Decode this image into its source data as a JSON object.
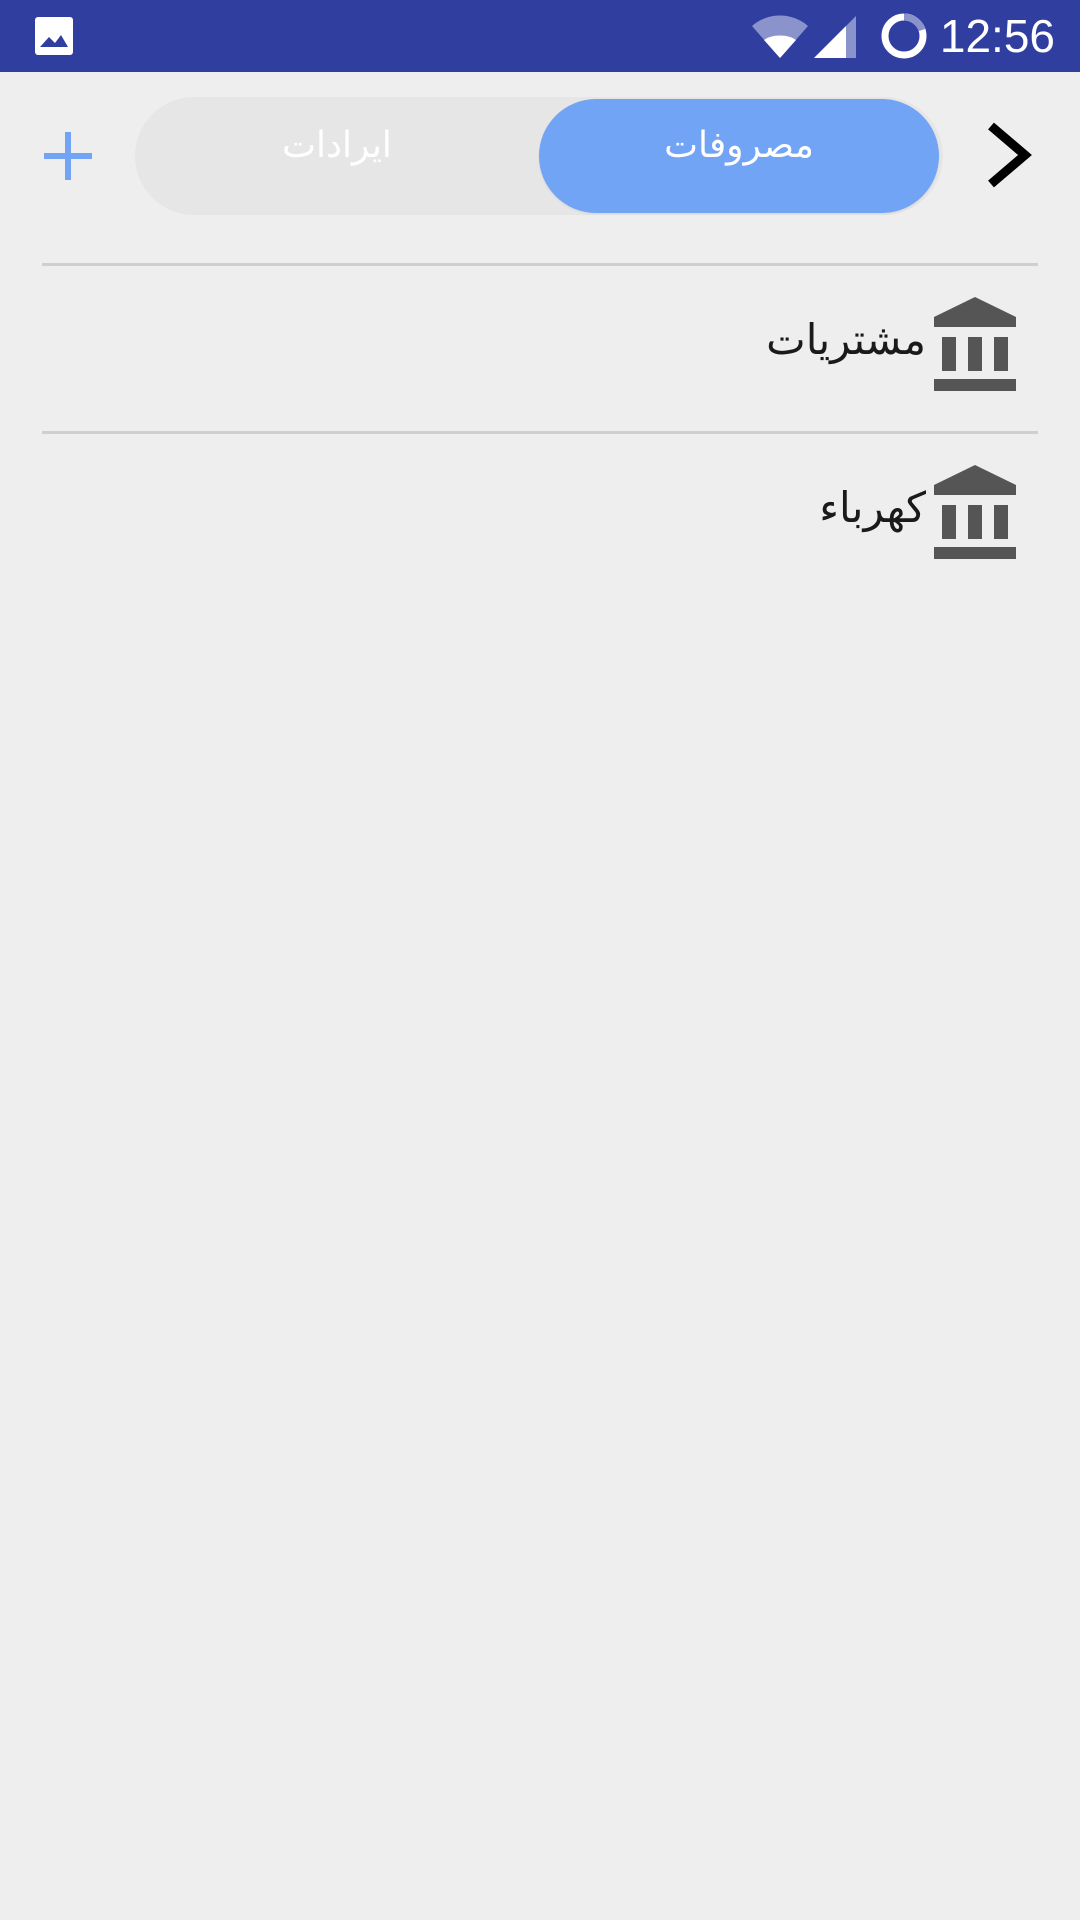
{
  "status_bar": {
    "time": "12:56",
    "icons": [
      "gallery-icon",
      "wifi-icon",
      "cell-signal-icon",
      "battery-icon"
    ]
  },
  "toolbar": {
    "add_icon": "plus-icon",
    "next_icon": "chevron-right-icon",
    "tabs": [
      {
        "label": "ایرادات",
        "active": false
      },
      {
        "label": "مصروفات",
        "active": true
      }
    ]
  },
  "list": {
    "items": [
      {
        "label": "مشتريات",
        "icon": "bank-icon"
      },
      {
        "label": "كهرباء",
        "icon": "bank-icon"
      }
    ]
  },
  "colors": {
    "status_bar": "#303f9f",
    "accent": "#72a4f5",
    "background": "#eeeeee",
    "segment_bg": "#e6e6e6",
    "icon_gray": "#555555"
  }
}
